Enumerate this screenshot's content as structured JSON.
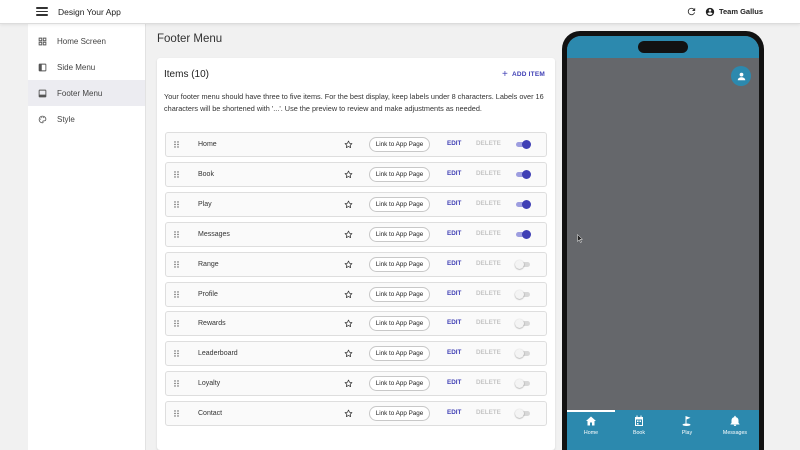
{
  "app": {
    "title": "Design Your App",
    "team_name": "Team Gallus"
  },
  "sidebar": {
    "items": [
      {
        "label": "Home Screen",
        "icon": "grid-icon",
        "active": false
      },
      {
        "label": "Side Menu",
        "icon": "side-menu-icon",
        "active": false
      },
      {
        "label": "Footer Menu",
        "icon": "footer-menu-icon",
        "active": true
      },
      {
        "label": "Style",
        "icon": "palette-icon",
        "active": false
      }
    ]
  },
  "main": {
    "page_title": "Footer Menu",
    "items_title": "Items (10)",
    "add_item_label": "ADD ITEM",
    "description": "Your footer menu should have three to five items. For the best display, keep labels under 8 characters. Labels over 16 characters will be shortened with '...'. Use the preview to review and make adjustments as needed.",
    "link_label": "Link to App Page",
    "edit_label": "EDIT",
    "delete_label": "DELETE",
    "rows": [
      {
        "label": "Home",
        "enabled": true
      },
      {
        "label": "Book",
        "enabled": true
      },
      {
        "label": "Play",
        "enabled": true
      },
      {
        "label": "Messages",
        "enabled": true
      },
      {
        "label": "Range",
        "enabled": false
      },
      {
        "label": "Profile",
        "enabled": false
      },
      {
        "label": "Rewards",
        "enabled": false
      },
      {
        "label": "Leaderboard",
        "enabled": false
      },
      {
        "label": "Loyalty",
        "enabled": false
      },
      {
        "label": "Contact",
        "enabled": false
      }
    ]
  },
  "preview": {
    "nav": [
      {
        "label": "Home",
        "icon": "home-icon"
      },
      {
        "label": "Book",
        "icon": "calendar-icon"
      },
      {
        "label": "Play",
        "icon": "golf-flag-icon"
      },
      {
        "label": "Messages",
        "icon": "bell-icon"
      }
    ]
  },
  "colors": {
    "accent": "#3f3fb5",
    "phone_brand": "#2c89ae",
    "phone_body": "#65676b"
  }
}
